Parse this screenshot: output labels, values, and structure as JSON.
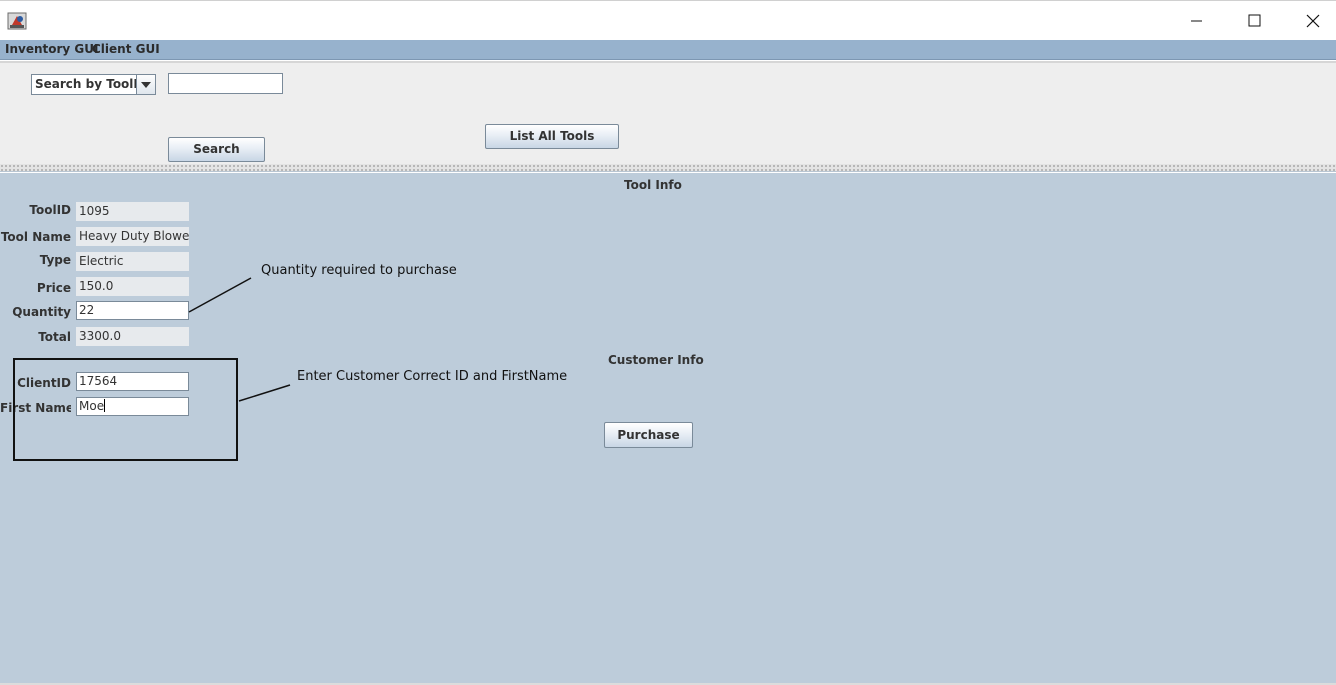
{
  "menu": {
    "items": [
      "Inventory GUI",
      "Client GUI"
    ]
  },
  "window_controls": {
    "minimize": "minimize-icon",
    "maximize": "maximize-icon",
    "close": "close-icon"
  },
  "search": {
    "mode_label": "Search by ToolID",
    "query_value": "",
    "search_button": "Search",
    "list_all_button": "List All Tools"
  },
  "tool_info": {
    "title": "Tool Info",
    "tool_id_label": "ToolID",
    "tool_id": "1095",
    "tool_name_label": "Tool Name",
    "tool_name": "Heavy Duty Blower",
    "type_label": "Type",
    "type": "Electric",
    "price_label": "Price",
    "price": "150.0",
    "quantity_label": "Quantity",
    "quantity": "22",
    "total_label": "Total",
    "total": "3300.0"
  },
  "customer_info": {
    "title": "Customer Info",
    "client_id_label": "ClientID",
    "client_id": "17564",
    "first_name_label": "First Name",
    "first_name": "Moe",
    "purchase_button": "Purchase"
  },
  "annotations": {
    "quantity_note": "Quantity required to purchase",
    "customer_note": "Enter Customer Correct ID and FirstName"
  },
  "colors": {
    "menubar": "#97b2cd",
    "content_background": "#bdccda",
    "top_panel": "#eeeeee"
  }
}
